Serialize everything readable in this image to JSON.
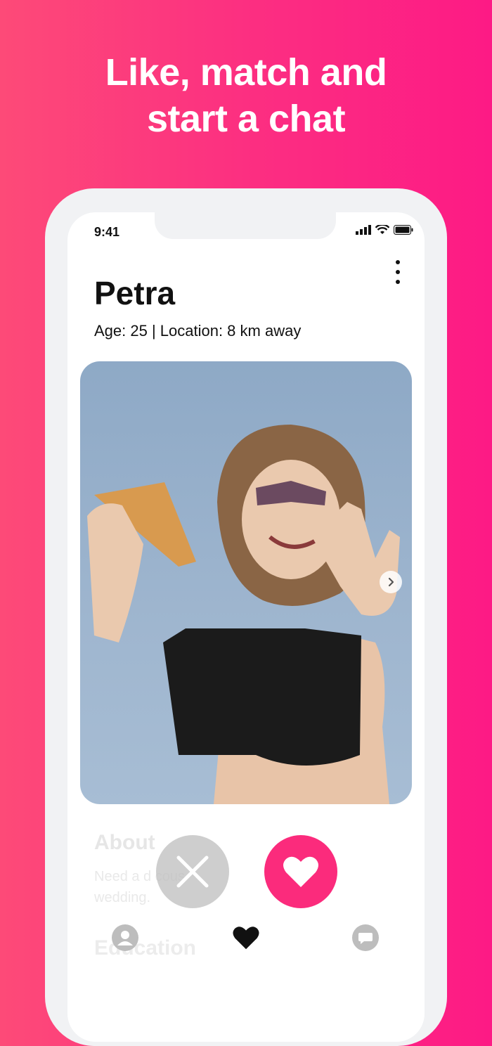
{
  "headline": "Like, match and\nstart a chat",
  "status_bar": {
    "time": "9:41"
  },
  "profile": {
    "name": "Petra",
    "meta": "Age: 25 | Location: 8 km away",
    "photo_alt": "Profile photo"
  },
  "about": {
    "title": "About",
    "text": "Need a d              cous\nwedding."
  },
  "education": {
    "title": "Education"
  },
  "actions": {
    "dislike": "dislike",
    "like": "like"
  },
  "tabs": [
    "profile",
    "likes",
    "chat"
  ],
  "colors": {
    "accent": "#fb2b7c",
    "bg_start": "#fd4a78",
    "bg_end": "#fd1a85"
  }
}
